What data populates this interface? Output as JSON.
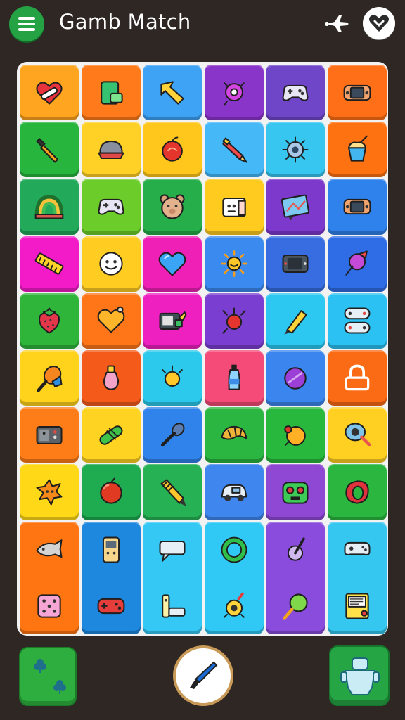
{
  "header": {
    "title": "Gamb Match",
    "menu_icon": "hamburger-icon",
    "left_action_icon": "airplane-icon",
    "right_action_icon": "heart-icon"
  },
  "board": {
    "columns": 6,
    "rows": 8,
    "tiles": [
      {
        "color": "#ffa51f",
        "icon": "heart-bandage"
      },
      {
        "color": "#ff7a1a",
        "icon": "battery"
      },
      {
        "color": "#3ea2f5",
        "icon": "arrow-cursor"
      },
      {
        "color": "#8a35c9",
        "icon": "alien-bug"
      },
      {
        "color": "#7046c9",
        "icon": "gamepad"
      },
      {
        "color": "#ff6f17",
        "icon": "handheld-console"
      },
      {
        "color": "#27b53e",
        "icon": "brush"
      },
      {
        "color": "#ffd126",
        "icon": "helmet"
      },
      {
        "color": "#ffc71c",
        "icon": "apple"
      },
      {
        "color": "#45b8f8",
        "icon": "crayon"
      },
      {
        "color": "#36c6ef",
        "icon": "virus"
      },
      {
        "color": "#ff7212",
        "icon": "ice-cream-cup"
      },
      {
        "color": "#22a95a",
        "icon": "rainbow"
      },
      {
        "color": "#6ccd2a",
        "icon": "gamepad"
      },
      {
        "color": "#26ae4a",
        "icon": "bear-face"
      },
      {
        "color": "#ffcb1f",
        "icon": "toy-robot"
      },
      {
        "color": "#7c39cc",
        "icon": "map-frame"
      },
      {
        "color": "#2f82ec",
        "icon": "handheld-console"
      },
      {
        "color": "#f31bc8",
        "icon": "ruler"
      },
      {
        "color": "#ffcc22",
        "icon": "smiley-face"
      },
      {
        "color": "#ef20b6",
        "icon": "blue-heart"
      },
      {
        "color": "#3b8af0",
        "icon": "sun"
      },
      {
        "color": "#376de0",
        "icon": "portable-console"
      },
      {
        "color": "#2f6de6",
        "icon": "toy-pin"
      },
      {
        "color": "#2fb53a",
        "icon": "strawberry"
      },
      {
        "color": "#ff7618",
        "icon": "orange-heart"
      },
      {
        "color": "#ee20bf",
        "icon": "console-device"
      },
      {
        "color": "#7a3ed0",
        "icon": "cherry-bomb"
      },
      {
        "color": "#2cc8f2",
        "icon": "marker"
      },
      {
        "color": "#2bc1f2",
        "icon": "twin-controllers"
      },
      {
        "color": "#ffd21c",
        "icon": "ice-pop"
      },
      {
        "color": "#f45a1a",
        "icon": "potion"
      },
      {
        "color": "#2cc9ec",
        "icon": "light-bulb"
      },
      {
        "color": "#f44b78",
        "icon": "bottle"
      },
      {
        "color": "#3a86ee",
        "icon": "purple-ball"
      },
      {
        "color": "#fb6a14",
        "icon": "padlock"
      },
      {
        "color": "#ff7d18",
        "icon": "old-console"
      },
      {
        "color": "#ffd321",
        "icon": "candy-pill"
      },
      {
        "color": "#3183ec",
        "icon": "paint-brush"
      },
      {
        "color": "#2bb541",
        "icon": "croissant"
      },
      {
        "color": "#28b83d",
        "icon": "orange-ball"
      },
      {
        "color": "#ffd022",
        "icon": "ping-pong"
      },
      {
        "color": "#ffd918",
        "icon": "spiky-sun"
      },
      {
        "color": "#1fab50",
        "icon": "red-ball"
      },
      {
        "color": "#27b155",
        "icon": "pencil"
      },
      {
        "color": "#3f86ee",
        "icon": "toy-car"
      },
      {
        "color": "#8e48d4",
        "icon": "frog-face"
      },
      {
        "color": "#2bb640",
        "icon": "red-ring"
      }
    ],
    "tall_tiles": [
      {
        "color": "#ff7512",
        "icons": [
          "fish",
          "dice"
        ]
      },
      {
        "color": "#1e88df",
        "icons": [
          "walkie-talkie",
          "red-gamepad"
        ]
      },
      {
        "color": "#36c8f4",
        "icons": [
          "speech-bubble",
          "phone-dock"
        ]
      },
      {
        "color": "#30c8f4",
        "icons": [
          "green-ring",
          "bomb-timer"
        ]
      },
      {
        "color": "#8a4cdc",
        "icons": [
          "gauge",
          "green-lollipop"
        ]
      },
      {
        "color": "#35c7f0",
        "icons": [
          "joystick",
          "game-cartridge"
        ]
      }
    ]
  },
  "footer": {
    "left_icon": "clover-icon",
    "center_icon": "brush-tool-icon",
    "right_icon": "robot-figure-icon"
  }
}
